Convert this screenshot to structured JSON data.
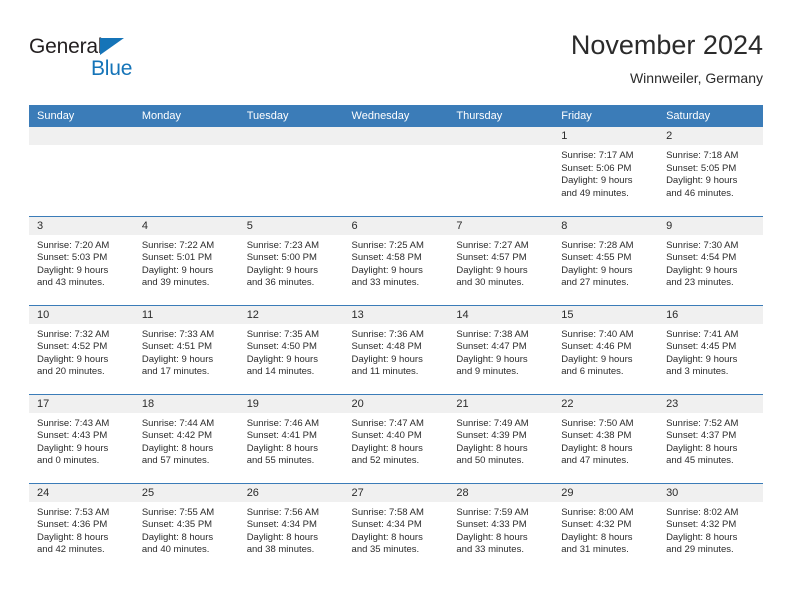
{
  "brand": {
    "line1": "General",
    "line2": "Blue",
    "triangle_icon": "blue-triangle-icon",
    "accent_color": "#1574b8"
  },
  "header": {
    "title": "November 2024",
    "subtitle": "Winnweiler, Germany"
  },
  "calendar": {
    "header_bg": "#3b7cb8",
    "daynum_bg": "#f0f0f0",
    "weekday_headers": [
      "Sunday",
      "Monday",
      "Tuesday",
      "Wednesday",
      "Thursday",
      "Friday",
      "Saturday"
    ],
    "weeks": [
      [
        {
          "day": "",
          "empty": true
        },
        {
          "day": "",
          "empty": true
        },
        {
          "day": "",
          "empty": true
        },
        {
          "day": "",
          "empty": true
        },
        {
          "day": "",
          "empty": true
        },
        {
          "day": "1",
          "sunrise": "Sunrise: 7:17 AM",
          "sunset": "Sunset: 5:06 PM",
          "daylight1": "Daylight: 9 hours",
          "daylight2": "and 49 minutes."
        },
        {
          "day": "2",
          "sunrise": "Sunrise: 7:18 AM",
          "sunset": "Sunset: 5:05 PM",
          "daylight1": "Daylight: 9 hours",
          "daylight2": "and 46 minutes."
        }
      ],
      [
        {
          "day": "3",
          "sunrise": "Sunrise: 7:20 AM",
          "sunset": "Sunset: 5:03 PM",
          "daylight1": "Daylight: 9 hours",
          "daylight2": "and 43 minutes."
        },
        {
          "day": "4",
          "sunrise": "Sunrise: 7:22 AM",
          "sunset": "Sunset: 5:01 PM",
          "daylight1": "Daylight: 9 hours",
          "daylight2": "and 39 minutes."
        },
        {
          "day": "5",
          "sunrise": "Sunrise: 7:23 AM",
          "sunset": "Sunset: 5:00 PM",
          "daylight1": "Daylight: 9 hours",
          "daylight2": "and 36 minutes."
        },
        {
          "day": "6",
          "sunrise": "Sunrise: 7:25 AM",
          "sunset": "Sunset: 4:58 PM",
          "daylight1": "Daylight: 9 hours",
          "daylight2": "and 33 minutes."
        },
        {
          "day": "7",
          "sunrise": "Sunrise: 7:27 AM",
          "sunset": "Sunset: 4:57 PM",
          "daylight1": "Daylight: 9 hours",
          "daylight2": "and 30 minutes."
        },
        {
          "day": "8",
          "sunrise": "Sunrise: 7:28 AM",
          "sunset": "Sunset: 4:55 PM",
          "daylight1": "Daylight: 9 hours",
          "daylight2": "and 27 minutes."
        },
        {
          "day": "9",
          "sunrise": "Sunrise: 7:30 AM",
          "sunset": "Sunset: 4:54 PM",
          "daylight1": "Daylight: 9 hours",
          "daylight2": "and 23 minutes."
        }
      ],
      [
        {
          "day": "10",
          "sunrise": "Sunrise: 7:32 AM",
          "sunset": "Sunset: 4:52 PM",
          "daylight1": "Daylight: 9 hours",
          "daylight2": "and 20 minutes."
        },
        {
          "day": "11",
          "sunrise": "Sunrise: 7:33 AM",
          "sunset": "Sunset: 4:51 PM",
          "daylight1": "Daylight: 9 hours",
          "daylight2": "and 17 minutes."
        },
        {
          "day": "12",
          "sunrise": "Sunrise: 7:35 AM",
          "sunset": "Sunset: 4:50 PM",
          "daylight1": "Daylight: 9 hours",
          "daylight2": "and 14 minutes."
        },
        {
          "day": "13",
          "sunrise": "Sunrise: 7:36 AM",
          "sunset": "Sunset: 4:48 PM",
          "daylight1": "Daylight: 9 hours",
          "daylight2": "and 11 minutes."
        },
        {
          "day": "14",
          "sunrise": "Sunrise: 7:38 AM",
          "sunset": "Sunset: 4:47 PM",
          "daylight1": "Daylight: 9 hours",
          "daylight2": "and 9 minutes."
        },
        {
          "day": "15",
          "sunrise": "Sunrise: 7:40 AM",
          "sunset": "Sunset: 4:46 PM",
          "daylight1": "Daylight: 9 hours",
          "daylight2": "and 6 minutes."
        },
        {
          "day": "16",
          "sunrise": "Sunrise: 7:41 AM",
          "sunset": "Sunset: 4:45 PM",
          "daylight1": "Daylight: 9 hours",
          "daylight2": "and 3 minutes."
        }
      ],
      [
        {
          "day": "17",
          "sunrise": "Sunrise: 7:43 AM",
          "sunset": "Sunset: 4:43 PM",
          "daylight1": "Daylight: 9 hours",
          "daylight2": "and 0 minutes."
        },
        {
          "day": "18",
          "sunrise": "Sunrise: 7:44 AM",
          "sunset": "Sunset: 4:42 PM",
          "daylight1": "Daylight: 8 hours",
          "daylight2": "and 57 minutes."
        },
        {
          "day": "19",
          "sunrise": "Sunrise: 7:46 AM",
          "sunset": "Sunset: 4:41 PM",
          "daylight1": "Daylight: 8 hours",
          "daylight2": "and 55 minutes."
        },
        {
          "day": "20",
          "sunrise": "Sunrise: 7:47 AM",
          "sunset": "Sunset: 4:40 PM",
          "daylight1": "Daylight: 8 hours",
          "daylight2": "and 52 minutes."
        },
        {
          "day": "21",
          "sunrise": "Sunrise: 7:49 AM",
          "sunset": "Sunset: 4:39 PM",
          "daylight1": "Daylight: 8 hours",
          "daylight2": "and 50 minutes."
        },
        {
          "day": "22",
          "sunrise": "Sunrise: 7:50 AM",
          "sunset": "Sunset: 4:38 PM",
          "daylight1": "Daylight: 8 hours",
          "daylight2": "and 47 minutes."
        },
        {
          "day": "23",
          "sunrise": "Sunrise: 7:52 AM",
          "sunset": "Sunset: 4:37 PM",
          "daylight1": "Daylight: 8 hours",
          "daylight2": "and 45 minutes."
        }
      ],
      [
        {
          "day": "24",
          "sunrise": "Sunrise: 7:53 AM",
          "sunset": "Sunset: 4:36 PM",
          "daylight1": "Daylight: 8 hours",
          "daylight2": "and 42 minutes."
        },
        {
          "day": "25",
          "sunrise": "Sunrise: 7:55 AM",
          "sunset": "Sunset: 4:35 PM",
          "daylight1": "Daylight: 8 hours",
          "daylight2": "and 40 minutes."
        },
        {
          "day": "26",
          "sunrise": "Sunrise: 7:56 AM",
          "sunset": "Sunset: 4:34 PM",
          "daylight1": "Daylight: 8 hours",
          "daylight2": "and 38 minutes."
        },
        {
          "day": "27",
          "sunrise": "Sunrise: 7:58 AM",
          "sunset": "Sunset: 4:34 PM",
          "daylight1": "Daylight: 8 hours",
          "daylight2": "and 35 minutes."
        },
        {
          "day": "28",
          "sunrise": "Sunrise: 7:59 AM",
          "sunset": "Sunset: 4:33 PM",
          "daylight1": "Daylight: 8 hours",
          "daylight2": "and 33 minutes."
        },
        {
          "day": "29",
          "sunrise": "Sunrise: 8:00 AM",
          "sunset": "Sunset: 4:32 PM",
          "daylight1": "Daylight: 8 hours",
          "daylight2": "and 31 minutes."
        },
        {
          "day": "30",
          "sunrise": "Sunrise: 8:02 AM",
          "sunset": "Sunset: 4:32 PM",
          "daylight1": "Daylight: 8 hours",
          "daylight2": "and 29 minutes."
        }
      ]
    ]
  }
}
